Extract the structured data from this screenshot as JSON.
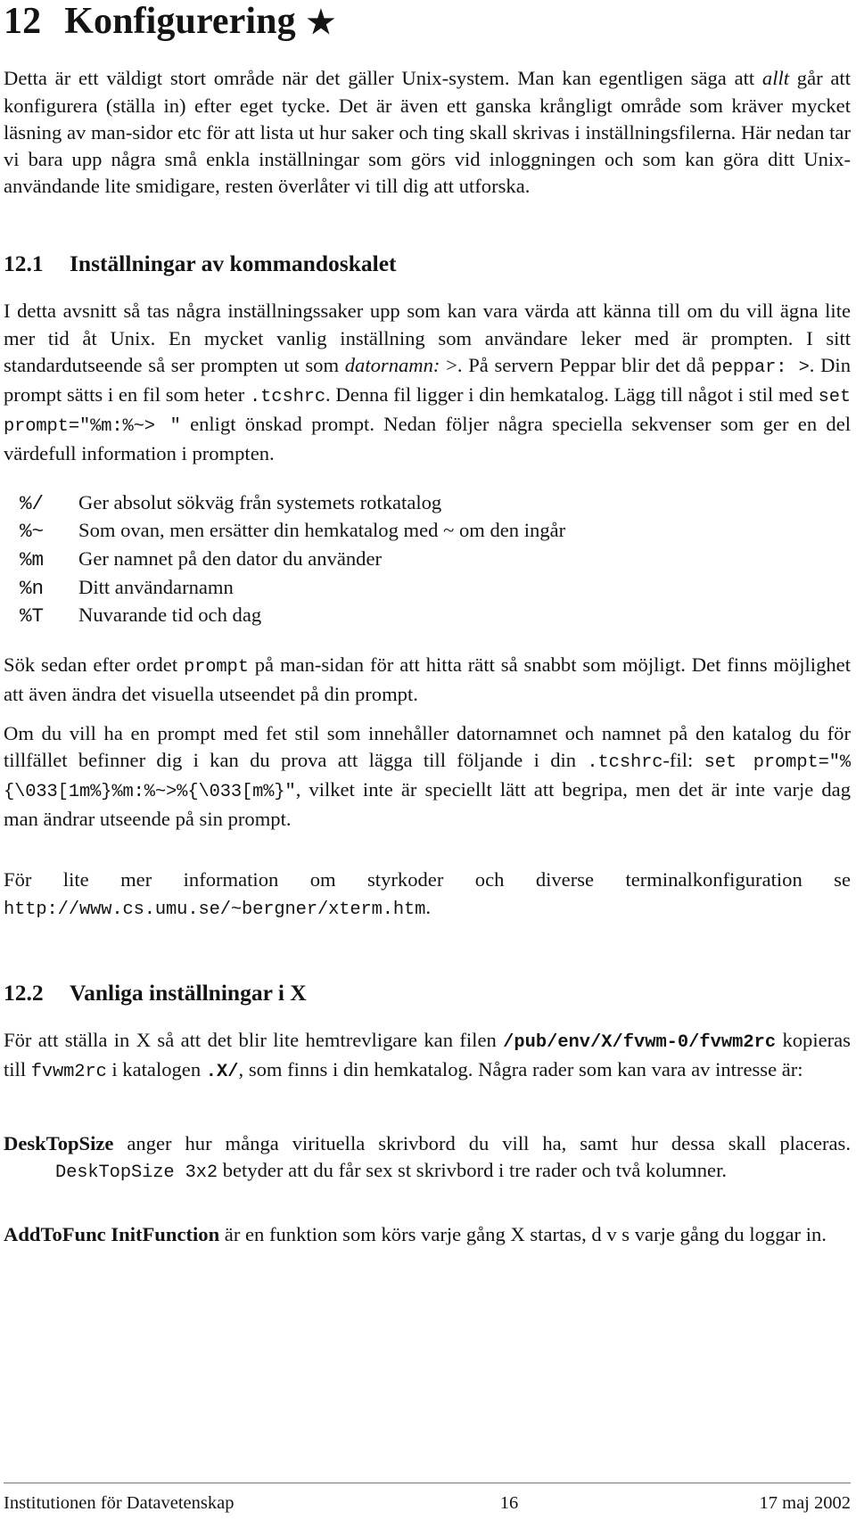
{
  "document": {
    "language": "sv",
    "page_number": "16"
  },
  "chapter": {
    "number": "12",
    "title": "Konfigurering",
    "star_icon": "★"
  },
  "intro": {
    "part1": "Detta är ett väldigt stort område när det gäller Unix-system. Man kan egentligen säga att ",
    "emph1": "allt",
    "part2": " går att konfigurera (ställa in) efter eget tycke. Det är även ett ganska krångligt område som kräver mycket läsning av man-sidor etc för att lista ut hur saker och ting skall skrivas i inställningsfilerna. Här nedan tar vi bara upp några små enkla inställningar som görs vid inloggningen och som kan göra ditt Unix-användande lite smidigare, resten överlåter vi till dig att utforska."
  },
  "section_12_1": {
    "number": "12.1",
    "title": "Inställningar av kommandoskalet",
    "para1": {
      "t1": "I detta avsnitt så tas några inställningssaker upp som kan vara värda att känna till om du vill ägna lite mer tid åt Unix. En mycket vanlig inställning som användare leker med är prompten. I sitt standardutseende så ser prompten ut som ",
      "emph_datornamn": "datornamn:",
      "t2": " >. På servern Peppar blir det då ",
      "code_peppar": "peppar:  >",
      "t3": ". Din prompt sätts i en fil som heter ",
      "code_tcshrc": ".tcshrc",
      "t4": ". Denna fil ligger i din hemkatalog. Lägg till något i stil med ",
      "code_setprompt": "set prompt=\"%m:%~> \"",
      "t5": " enligt önskad prompt. Nedan följer några speciella sekvenser som ger en del värdefull information i prompten."
    },
    "escape_table": [
      {
        "code": "%/",
        "description": "Ger absolut sökväg från systemets rotkatalog"
      },
      {
        "code": "%~",
        "description": "Som ovan, men ersätter din hemkatalog med ~ om den ingår"
      },
      {
        "code": "%m",
        "description": "Ger namnet på den dator du använder"
      },
      {
        "code": "%n",
        "description": "Ditt användarnamn"
      },
      {
        "code": "%T",
        "description": "Nuvarande tid och dag"
      }
    ],
    "para2": {
      "t1": "Sök sedan efter ordet ",
      "code_prompt": "prompt",
      "t2": " på man-sidan för att hitta rätt så snabbt som möjligt. Det finns möjlighet att även ändra det visuella utseendet på din prompt."
    },
    "para3": {
      "t1": "Om du vill ha en prompt med fet stil som innehåller datornamnet och namnet på den katalog du för tillfället befinner dig i kan du prova att lägga till följande i din ",
      "code_tcshrc": ".tcshrc",
      "t2": "-fil: ",
      "code_prompt_full": "set prompt=\"%{\\033[1m%}%m:%~>%{\\033[m%}\"",
      "t3": ", vilket inte är speciellt lätt att begripa, men det är inte varje dag man ändrar utseende på sin prompt."
    },
    "para4": {
      "t1": "För lite mer information om styrkoder och diverse terminalkonfiguration se ",
      "url": "http://www.cs.umu.se/~bergner/xterm.htm",
      "t2": "."
    }
  },
  "section_12_2": {
    "number": "12.2",
    "title": "Vanliga inställningar i X",
    "para1": {
      "t1": "För att ställa in X så att det blir lite hemtrevligare kan filen ",
      "code_path": "/pub/env/X/fvwm-0/fvwm2rc",
      "t2": " kopieras till ",
      "code_fvwm2rc": "fvwm2rc",
      "t3": " i katalogen ",
      "code_xdir": ".X/",
      "t4": ", som finns i din hemkatalog. Några rader som kan vara av intresse är:"
    },
    "entries": [
      {
        "term": "DeskTopSize",
        "t1": " anger hur många virituella skrivbord du vill ha, samt hur dessa skall placeras. ",
        "code": "DeskTopSize  3x2",
        "t2": " betyder att du får sex st skrivbord i tre rader och två kolumner."
      },
      {
        "term": "AddToFunc InitFunction",
        "t1": " är en funktion som körs varje gång X startas, d v s varje gång du loggar in.",
        "code": "",
        "t2": ""
      }
    ]
  },
  "footer": {
    "left": "Institutionen för Datavetenskap",
    "center": "16",
    "right": "17 maj 2002"
  }
}
